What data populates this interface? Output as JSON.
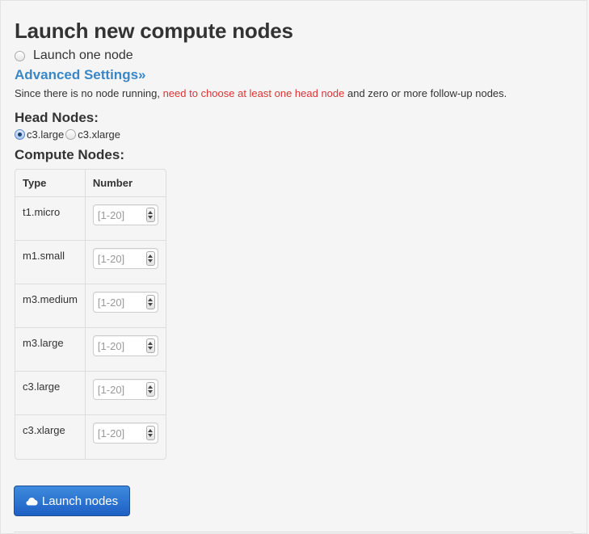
{
  "page": {
    "title": "Launch new compute nodes",
    "launch_one_label": "Launch one node",
    "advanced_link": "Advanced Settings»"
  },
  "notice": {
    "before": "Since there is no node running, ",
    "highlight": "need to choose at least one head node",
    "after": " and zero or more follow-up nodes.",
    "highlight_color": "#dd3333"
  },
  "head_nodes": {
    "heading": "Head Nodes:",
    "options": [
      {
        "label": "c3.large",
        "selected": true
      },
      {
        "label": "c3.xlarge",
        "selected": false
      }
    ]
  },
  "compute_nodes": {
    "heading": "Compute Nodes:",
    "columns": [
      "Type",
      "Number"
    ],
    "placeholder": "[1-20]",
    "rows": [
      {
        "type": "t1.micro"
      },
      {
        "type": "m1.small"
      },
      {
        "type": "m3.medium"
      },
      {
        "type": "m3.large"
      },
      {
        "type": "c3.large"
      },
      {
        "type": "c3.xlarge"
      }
    ]
  },
  "launch_button": {
    "label": "Launch nodes",
    "icon": "cloud-icon",
    "color": "#2a74d2"
  },
  "colors": {
    "link": "#3a87c7",
    "warning": "#dd3333",
    "background": "#f5f5f5"
  }
}
